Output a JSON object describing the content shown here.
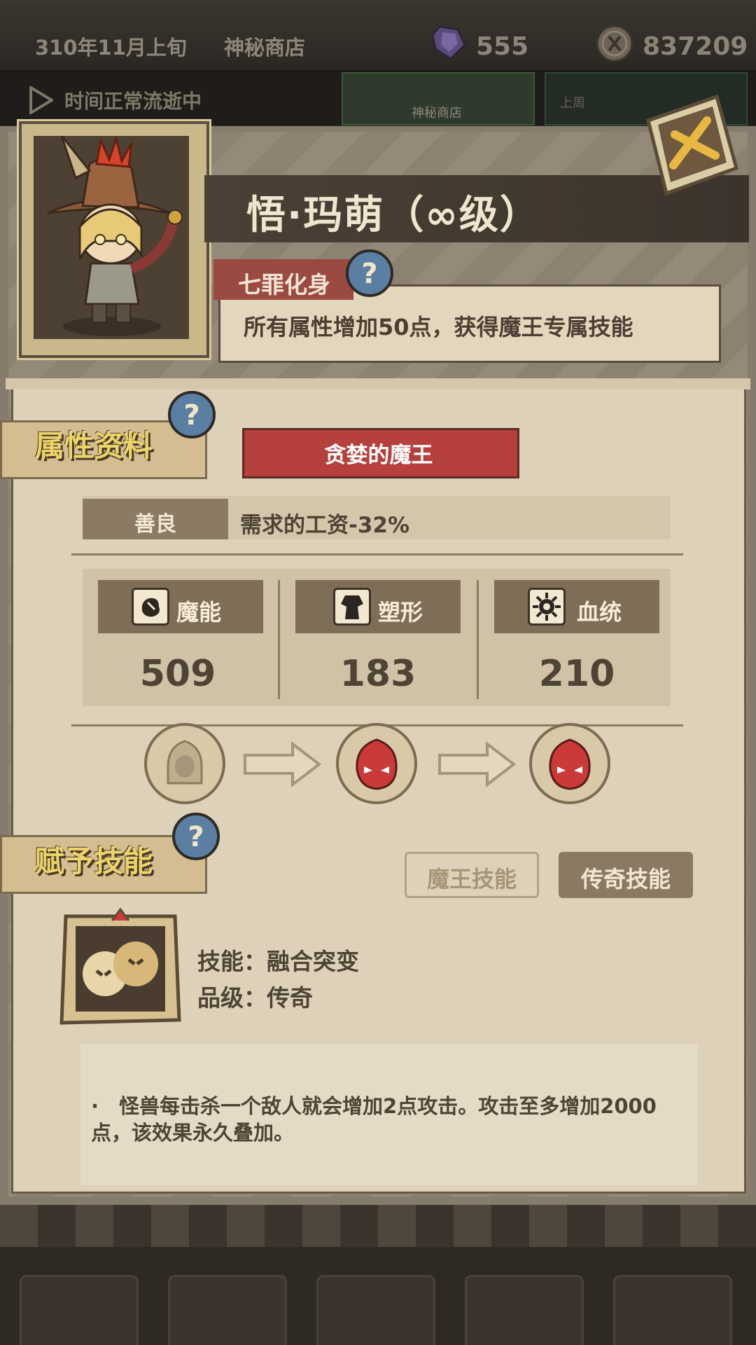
{
  "topbar": {
    "date": "310年11月上旬",
    "location": "神秘商店",
    "gems": "555",
    "coins": "837209"
  },
  "timebar": {
    "status": "时间正常流逝中",
    "tab_shop": "神秘商店",
    "tab_other": "上周"
  },
  "character": {
    "name": "悟·玛萌（∞级）",
    "trait_tag": "七罪化身",
    "trait_desc": "所有属性增加50点，获得魔王专属技能"
  },
  "attributes": {
    "section_title": "属性资料",
    "class_banner": "贪婪的魔王",
    "alignment_label": "善良",
    "alignment_effect": "需求的工资-32%",
    "stats": [
      {
        "label": "魔能",
        "value": "509",
        "icon": "magic-fist-icon"
      },
      {
        "label": "塑形",
        "value": "183",
        "icon": "body-shape-icon"
      },
      {
        "label": "血统",
        "value": "210",
        "icon": "bloodline-icon"
      }
    ]
  },
  "skills": {
    "section_title": "赋予技能",
    "tab_demon": "魔王技能",
    "tab_legend": "传奇技能",
    "skill_name": "技能：融合突变",
    "skill_grade": "品级：传奇",
    "skill_desc": "·　怪兽每击杀一个敌人就会增加2点攻击。攻击至多增加2000点，该效果永久叠加。"
  },
  "colors": {
    "accent_red": "#b5403c",
    "title_yellow": "#ecd46a",
    "parchment": "#ddd2b9",
    "text_brown": "#4e4435"
  }
}
